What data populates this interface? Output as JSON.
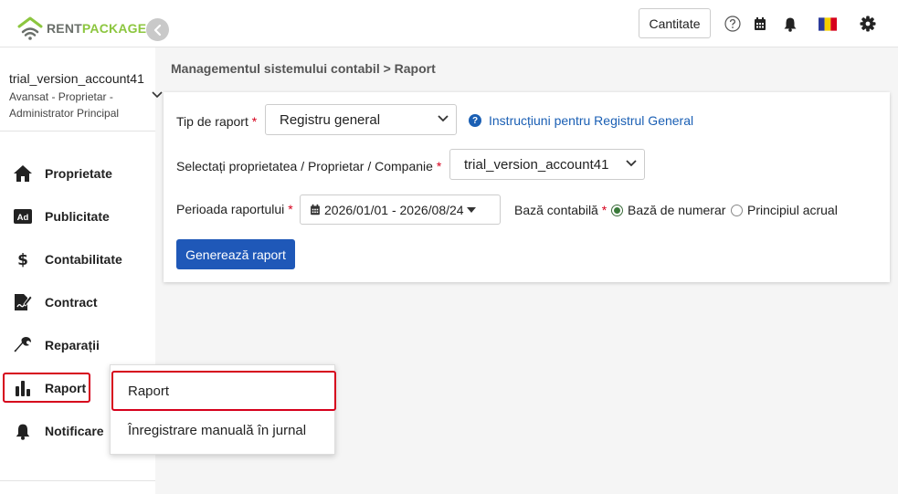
{
  "header": {
    "logo_rent": "RENT",
    "logo_package": "PACKAGE",
    "quantity_button": "Cantitate"
  },
  "account": {
    "name": "trial_version_account41",
    "role_line1": "Avansat - Proprietar -",
    "role_line2": "Administrator Principal"
  },
  "sidebar": {
    "items": [
      {
        "label": "Proprietate",
        "icon": "home-icon"
      },
      {
        "label": "Publicitate",
        "icon": "ad-icon"
      },
      {
        "label": "Contabilitate",
        "icon": "dollar-icon"
      },
      {
        "label": "Contract",
        "icon": "contract-icon"
      },
      {
        "label": "Reparații",
        "icon": "wrench-icon"
      },
      {
        "label": "Raport",
        "icon": "bar-chart-icon"
      },
      {
        "label": "Notificare",
        "icon": "bell-icon"
      }
    ]
  },
  "breadcrumb": "Managementul sistemului contabil > Raport",
  "form": {
    "report_type_label": "Tip de raport",
    "report_type_value": "Registru general",
    "help_link": "Instrucțiuni pentru Registrul General",
    "property_label": "Selectați proprietatea / Proprietar / Companie",
    "property_value": "trial_version_account41",
    "period_label": "Perioada raportului",
    "period_value": "2026/01/01 - 2026/08/24",
    "basis_label": "Bază contabilă",
    "basis_options": [
      "Bază de numerar",
      "Principiul acrual"
    ],
    "basis_selected": "Bază de numerar",
    "required_mark": "*",
    "generate_button": "Generează raport"
  },
  "report_menu": {
    "items": [
      "Raport",
      "Înregistrare manuală în jurnal"
    ]
  },
  "colors": {
    "primary": "#1f58b8",
    "highlight": "#d6001c",
    "brand_green": "#8cc63f"
  }
}
